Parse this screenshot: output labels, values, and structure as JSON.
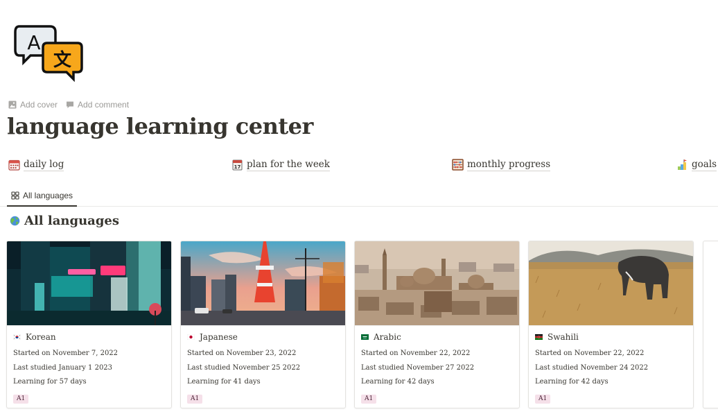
{
  "page": {
    "icon": "language-translate-icon",
    "add_cover": "Add cover",
    "add_comment": "Add comment",
    "title": "language learning center"
  },
  "links": [
    {
      "label": "daily log",
      "icon": "calendar-icon"
    },
    {
      "label": "plan for the week",
      "icon": "tear-off-calendar-icon"
    },
    {
      "label": "monthly progress",
      "icon": "abacus-icon"
    },
    {
      "label": "goals",
      "icon": "goal-flag-icon"
    }
  ],
  "view_tab": {
    "label": "All languages",
    "icon": "gallery-icon"
  },
  "section": {
    "title": "All languages",
    "icon": "globe-icon"
  },
  "cards": [
    {
      "name": "Korean",
      "flag": "korea-flag",
      "started": "Started on November 7, 2022",
      "last_studied": "Last studied January 1 2023",
      "learning_for": "Learning for 57 days",
      "level": "A1",
      "image": "neon-street-night"
    },
    {
      "name": "Japanese",
      "flag": "japan-flag",
      "started": "Started on November 23, 2022",
      "last_studied": "Last studied November 25 2022",
      "learning_for": "Learning for 41 days",
      "level": "A1",
      "image": "tokyo-tower-sunset"
    },
    {
      "name": "Arabic",
      "flag": "saudi-flag",
      "started": "Started on November 22, 2022",
      "last_studied": "Last studied November 27 2022",
      "learning_for": "Learning for 42 days",
      "level": "A1",
      "image": "cairo-mosques"
    },
    {
      "name": "Swahili",
      "flag": "kenya-flag",
      "started": "Started on November 22, 2022",
      "last_studied": "Last studied November 24 2022",
      "learning_for": "Learning for 42 days",
      "level": "A1",
      "image": "savanna-elephant"
    }
  ],
  "colors": {
    "text": "#37352f",
    "muted": "#9b9a97",
    "tag_bg": "#f5e0e9",
    "tag_text": "#4c2337"
  }
}
